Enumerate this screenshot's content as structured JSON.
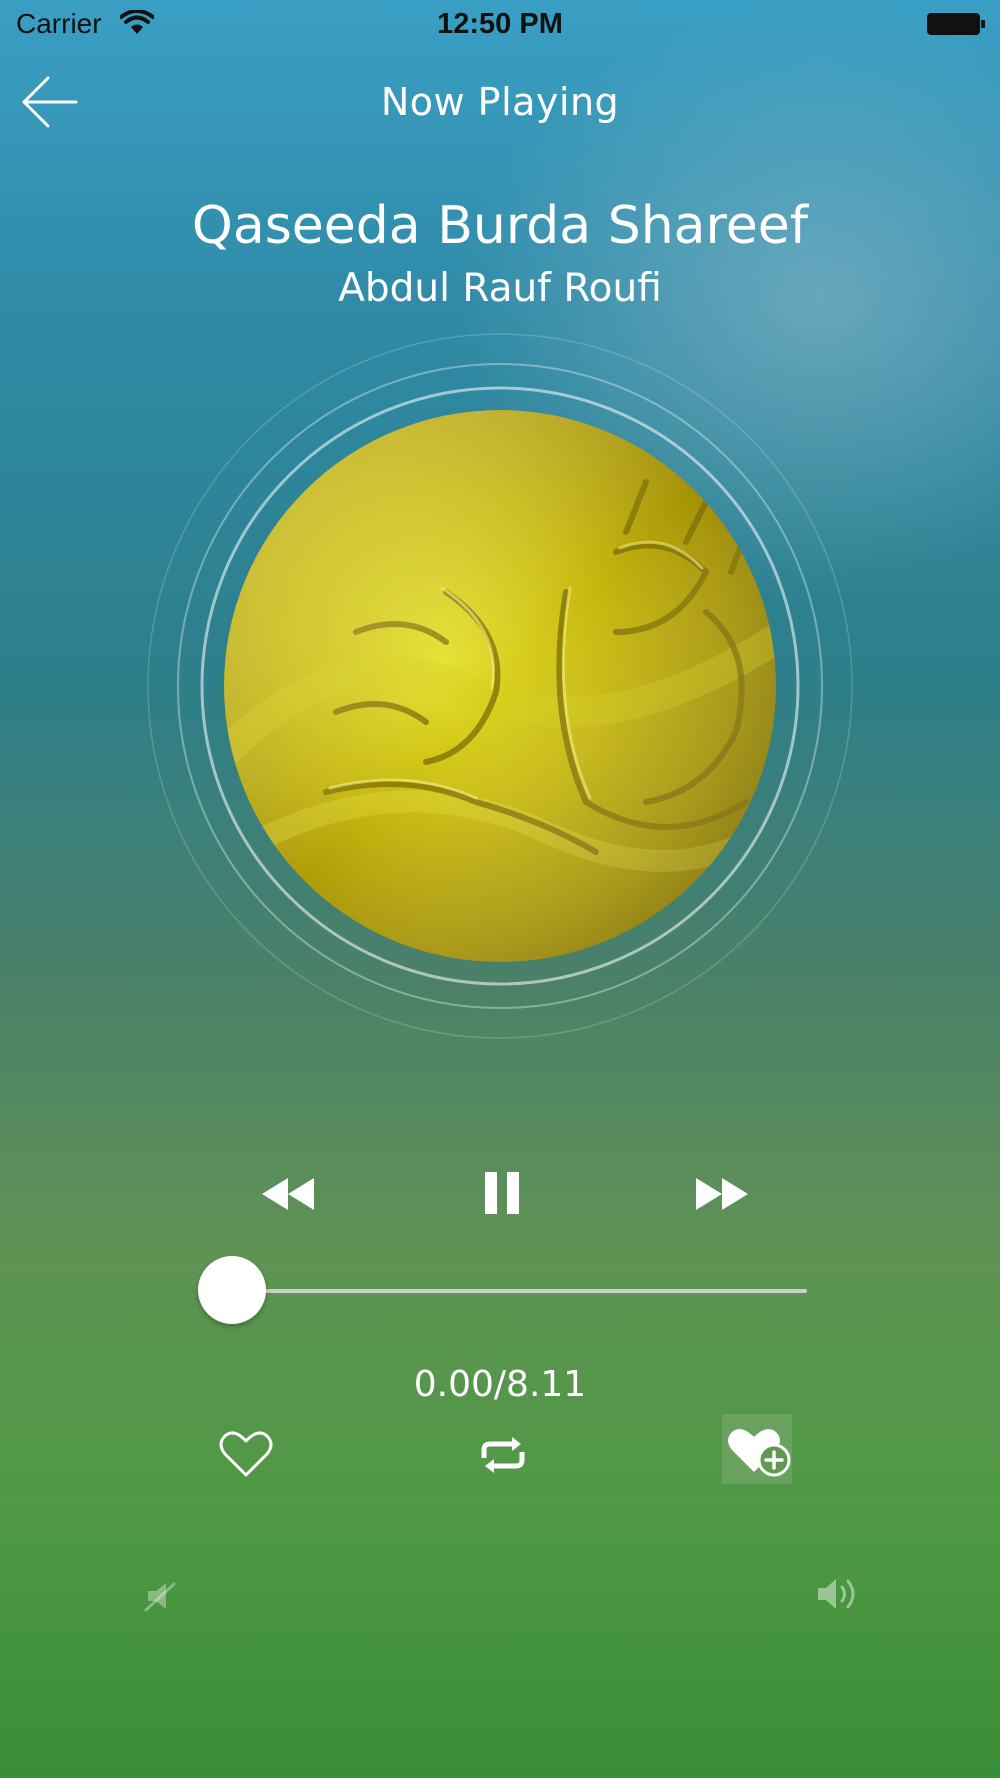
{
  "status_bar": {
    "carrier": "Carrier",
    "time": "12:50 PM"
  },
  "header": {
    "title": "Now Playing",
    "back_icon": "arrow-left-icon"
  },
  "track": {
    "title": "Qaseeda Burda Shareef",
    "artist": "Abdul Rauf Roufi"
  },
  "playback": {
    "state": "playing",
    "progress_fraction": 0.0,
    "time_text": "0.00/8.11"
  },
  "icons": {
    "rewind": "rewind-icon",
    "pause": "pause-icon",
    "fast_forward": "fast-forward-icon",
    "favorite": "heart-outline-icon",
    "repeat": "repeat-icon",
    "add_to_favorites": "heart-plus-icon",
    "volume_min": "volume-mute-icon",
    "volume_max": "volume-high-icon"
  },
  "colors": {
    "accent": "#ffffff",
    "artwork_gold": "#c9b60a"
  }
}
